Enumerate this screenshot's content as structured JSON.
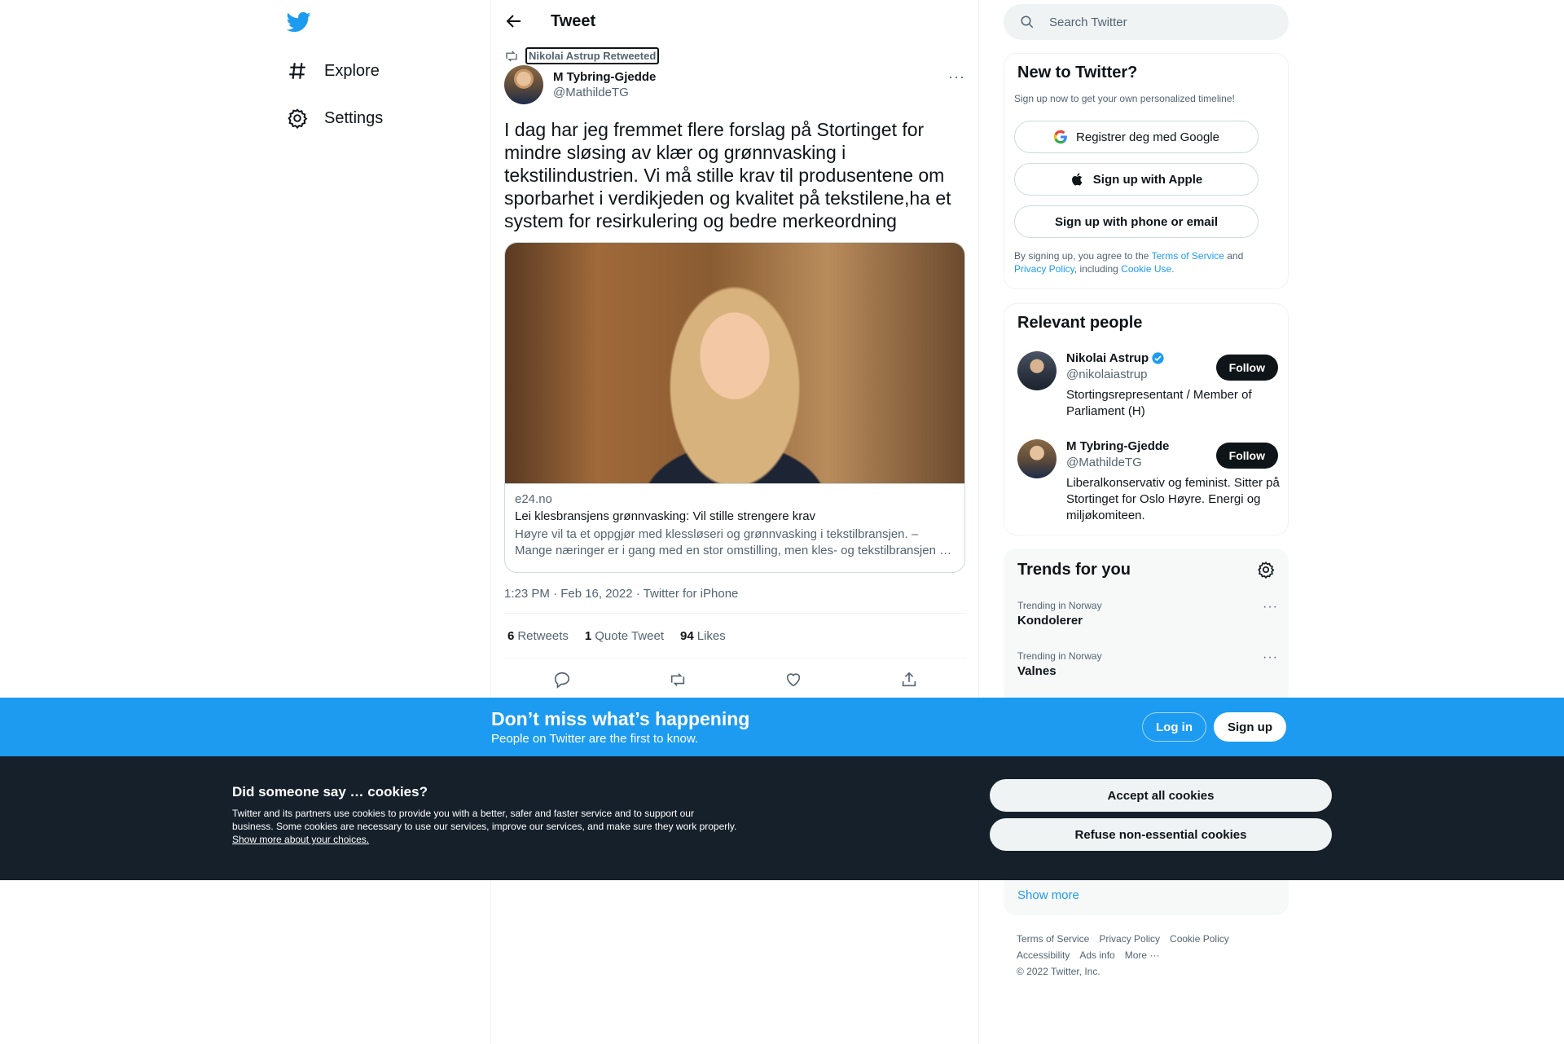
{
  "nav": {
    "explore": "Explore",
    "settings": "Settings"
  },
  "header": {
    "title": "Tweet"
  },
  "tweet": {
    "retweeted_by": "Nikolai Astrup Retweeted",
    "author_name": "M Tybring-Gjedde",
    "author_handle": "@MathildeTG",
    "text": "I dag har jeg fremmet flere forslag på Stortinget for mindre sløsing av klær og grønnvasking i tekstilindustrien. Vi må stille krav til produsentene om sporbarhet i verdikjeden og kvalitet på tekstilene,ha et system for resirkulering og bedre merkeordning",
    "card": {
      "domain": "e24.no",
      "title": "Lei klesbransjens grønnvasking: Vil stille strengere krav",
      "description_line1": "Høyre vil ta et oppgjør med klessløseri og grønnvasking i tekstilbransjen. –",
      "description_line2": "Mange næringer er i gang med en stor omstilling, men kles- og tekstilbransjen henger etter, sier Mathilde Tybring-Gjedde."
    },
    "meta": "1:23 PM · Feb 16, 2022 · Twitter for iPhone",
    "stats": {
      "retweets_count": "6",
      "retweets_label": "Retweets",
      "quotes_count": "1",
      "quotes_label": "Quote Tweet",
      "likes_count": "94",
      "likes_label": "Likes"
    }
  },
  "search": {
    "placeholder": "Search Twitter"
  },
  "signup": {
    "title": "New to Twitter?",
    "subtitle": "Sign up now to get your own personalized timeline!",
    "google": "Registrer deg med Google",
    "apple": "Sign up with Apple",
    "phone": "Sign up with phone or email",
    "legal_prefix": "By signing up, you agree to the ",
    "terms": "Terms of Service",
    "and": " and",
    "privacy": "Privacy Policy",
    "including": ", including ",
    "cookie": "Cookie Use."
  },
  "relevant": {
    "title": "Relevant people",
    "people": [
      {
        "name": "Nikolai Astrup",
        "handle": "@nikolaiastrup",
        "bio": "Stortingsrepresentant / Member of Parliament (H)",
        "follow": "Follow",
        "verified": true
      },
      {
        "name": "M Tybring-Gjedde",
        "handle": "@MathildeTG",
        "bio": "Liberalkonservativ og feminist. Sitter på Stortinget for Oslo Høyre. Energi og miljøkomiteen.",
        "follow": "Follow",
        "verified": false
      }
    ]
  },
  "trends": {
    "title": "Trends for you",
    "items": [
      {
        "context": "Trending in Norway",
        "name": "Kondolerer"
      },
      {
        "context": "Trending in Norway",
        "name": "Valnes"
      }
    ],
    "show_more": "Show more"
  },
  "footer": {
    "links": [
      "Terms of Service",
      "Privacy Policy",
      "Cookie Policy",
      "Accessibility",
      "Ads info",
      "More ···"
    ],
    "copyright": "© 2022 Twitter, Inc."
  },
  "banner": {
    "title": "Don’t miss what’s happening",
    "subtitle": "People on Twitter are the first to know.",
    "login": "Log in",
    "signup": "Sign up"
  },
  "cookie": {
    "title": "Did someone say … cookies?",
    "text": "Twitter and its partners use cookies to provide you with a better, safer and faster service and to support our business. Some cookies are necessary to use our services, improve our services, and make sure they work properly. ",
    "link": "Show more about your choices.",
    "accept": "Accept all cookies",
    "refuse": "Refuse non-essential cookies"
  },
  "colors": {
    "accent": "#1d9bf0",
    "text": "#0f1419",
    "muted": "#536471",
    "cookie_bg": "#15202b"
  }
}
